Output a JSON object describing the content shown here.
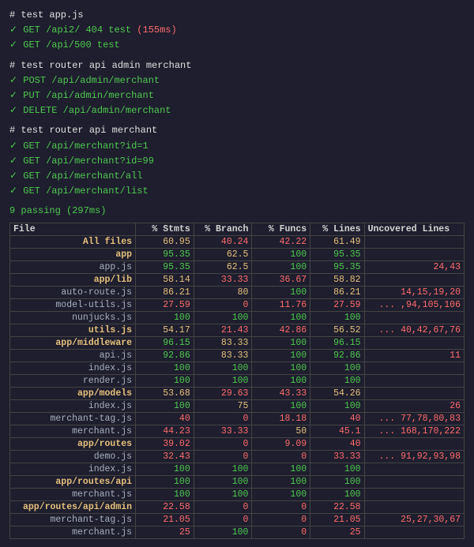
{
  "terminal": {
    "test_sections": [
      {
        "header": "# test app.js",
        "items": [
          {
            "check": "✓",
            "text": "GET /api2/ 404 test",
            "time": "(155ms)"
          },
          {
            "check": "✓",
            "text": "GET /api/500 test",
            "time": ""
          }
        ]
      },
      {
        "header": "# test router api admin merchant",
        "items": [
          {
            "check": "✓",
            "text": "POST /api/admin/merchant",
            "time": ""
          },
          {
            "check": "✓",
            "text": "PUT /api/admin/merchant",
            "time": ""
          },
          {
            "check": "✓",
            "text": "DELETE /api/admin/merchant",
            "time": ""
          }
        ]
      },
      {
        "header": "# test router api merchant",
        "items": [
          {
            "check": "✓",
            "text": "GET /api/merchant?id=1",
            "time": ""
          },
          {
            "check": "✓",
            "text": "GET /api/merchant?id=99",
            "time": ""
          },
          {
            "check": "✓",
            "text": "GET /api/merchant/all",
            "time": ""
          },
          {
            "check": "✓",
            "text": "GET /api/merchant/list",
            "time": ""
          }
        ]
      }
    ],
    "passing": "9 passing (297ms)",
    "table": {
      "headers": [
        "File",
        "% Stmts",
        "% Branch",
        "% Funcs",
        "% Lines",
        "Uncovered Lines"
      ],
      "rows": [
        {
          "file": "All files",
          "stmts": "60.95",
          "branch": "40.24",
          "funcs": "42.22",
          "lines": "61.49",
          "uncovered": "",
          "indent": false,
          "bold": true
        },
        {
          "file": "app",
          "stmts": "95.35",
          "branch": "62.5",
          "funcs": "100",
          "lines": "95.35",
          "uncovered": "",
          "indent": true,
          "bold": true
        },
        {
          "file": "app.js",
          "stmts": "95.35",
          "branch": "62.5",
          "funcs": "100",
          "lines": "95.35",
          "uncovered": "24,43",
          "indent": true,
          "bold": false
        },
        {
          "file": "app/lib",
          "stmts": "58.14",
          "branch": "33.33",
          "funcs": "36.67",
          "lines": "58.82",
          "uncovered": "",
          "indent": true,
          "bold": true
        },
        {
          "file": "auto-route.js",
          "stmts": "86.21",
          "branch": "80",
          "funcs": "100",
          "lines": "86.21",
          "uncovered": "14,15,19,20",
          "indent": true,
          "bold": false
        },
        {
          "file": "model-utils.js",
          "stmts": "27.59",
          "branch": "0",
          "funcs": "11.76",
          "lines": "27.59",
          "uncovered": "... ,94,105,106",
          "indent": true,
          "bold": false
        },
        {
          "file": "nunjucks.js",
          "stmts": "100",
          "branch": "100",
          "funcs": "100",
          "lines": "100",
          "uncovered": "",
          "indent": true,
          "bold": false
        },
        {
          "file": "utils.js",
          "stmts": "54.17",
          "branch": "21.43",
          "funcs": "42.86",
          "lines": "56.52",
          "uncovered": "... 40,42,67,76",
          "indent": true,
          "bold": true
        },
        {
          "file": "app/middleware",
          "stmts": "96.15",
          "branch": "83.33",
          "funcs": "100",
          "lines": "96.15",
          "uncovered": "",
          "indent": true,
          "bold": true
        },
        {
          "file": "api.js",
          "stmts": "92.86",
          "branch": "83.33",
          "funcs": "100",
          "lines": "92.86",
          "uncovered": "11",
          "indent": true,
          "bold": false
        },
        {
          "file": "index.js",
          "stmts": "100",
          "branch": "100",
          "funcs": "100",
          "lines": "100",
          "uncovered": "",
          "indent": true,
          "bold": false
        },
        {
          "file": "render.js",
          "stmts": "100",
          "branch": "100",
          "funcs": "100",
          "lines": "100",
          "uncovered": "",
          "indent": true,
          "bold": false
        },
        {
          "file": "app/models",
          "stmts": "53.68",
          "branch": "29.63",
          "funcs": "43.33",
          "lines": "54.26",
          "uncovered": "",
          "indent": true,
          "bold": true
        },
        {
          "file": "index.js",
          "stmts": "100",
          "branch": "75",
          "funcs": "100",
          "lines": "100",
          "uncovered": "26",
          "indent": true,
          "bold": false
        },
        {
          "file": "merchant-tag.js",
          "stmts": "40",
          "branch": "0",
          "funcs": "18.18",
          "lines": "40",
          "uncovered": "... 77,78,80,83",
          "indent": true,
          "bold": false
        },
        {
          "file": "merchant.js",
          "stmts": "44.23",
          "branch": "33.33",
          "funcs": "50",
          "lines": "45.1",
          "uncovered": "... 168,170,222",
          "indent": true,
          "bold": false
        },
        {
          "file": "app/routes",
          "stmts": "39.02",
          "branch": "0",
          "funcs": "9.09",
          "lines": "40",
          "uncovered": "",
          "indent": true,
          "bold": true
        },
        {
          "file": "demo.js",
          "stmts": "32.43",
          "branch": "0",
          "funcs": "0",
          "lines": "33.33",
          "uncovered": "... 91,92,93,98",
          "indent": true,
          "bold": false
        },
        {
          "file": "index.js",
          "stmts": "100",
          "branch": "100",
          "funcs": "100",
          "lines": "100",
          "uncovered": "",
          "indent": true,
          "bold": false
        },
        {
          "file": "app/routes/api",
          "stmts": "100",
          "branch": "100",
          "funcs": "100",
          "lines": "100",
          "uncovered": "",
          "indent": true,
          "bold": true
        },
        {
          "file": "merchant.js",
          "stmts": "100",
          "branch": "100",
          "funcs": "100",
          "lines": "100",
          "uncovered": "",
          "indent": true,
          "bold": false
        },
        {
          "file": "app/routes/api/admin",
          "stmts": "22.58",
          "branch": "0",
          "funcs": "0",
          "lines": "22.58",
          "uncovered": "",
          "indent": true,
          "bold": true
        },
        {
          "file": "merchant-tag.js",
          "stmts": "21.05",
          "branch": "0",
          "funcs": "0",
          "lines": "21.05",
          "uncovered": "25,27,30,67",
          "indent": true,
          "bold": false
        },
        {
          "file": "merchant.js",
          "stmts": "25",
          "branch": "100",
          "funcs": "0",
          "lines": "25",
          "uncovered": "",
          "indent": true,
          "bold": false
        }
      ]
    }
  }
}
